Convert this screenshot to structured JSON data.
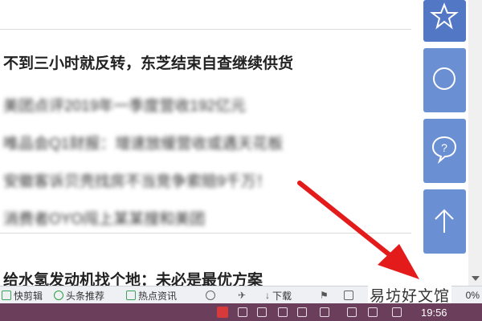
{
  "news": {
    "headline_1": "不到三小时就反转，东芝结束自查继续供货",
    "items": [
      "美团点评2019年一季度营收192亿元",
      "唯品会Q1财报：增速放缓营收或遇天花板",
      "安徽客诉贝壳找房不当竞争索赔9千万！",
      "消费者OYO闯上某某搜和美团"
    ],
    "headline_2": "给水氢发动机找个地：未必是最优方案"
  },
  "side_buttons": {
    "icons": [
      "star-icon",
      "chat-bubble-icon",
      "help-question-icon",
      "back-to-top-arrow-icon"
    ]
  },
  "toolbar": {
    "quick_cut": "快剪辑",
    "headline_recommend": "头条推荐",
    "hot_news": "热点资讯",
    "download": "下载",
    "zoom": "0%"
  },
  "watermark": "易坊好文馆",
  "taskbar": {
    "clock": "19:56"
  },
  "colors": {
    "side_button": "#6a8fd3",
    "side_button_top": "#5277c4",
    "arrow": "#e31b1b",
    "taskbar": "#6b3f5b",
    "toolbar_icon_green": "#27a244"
  }
}
